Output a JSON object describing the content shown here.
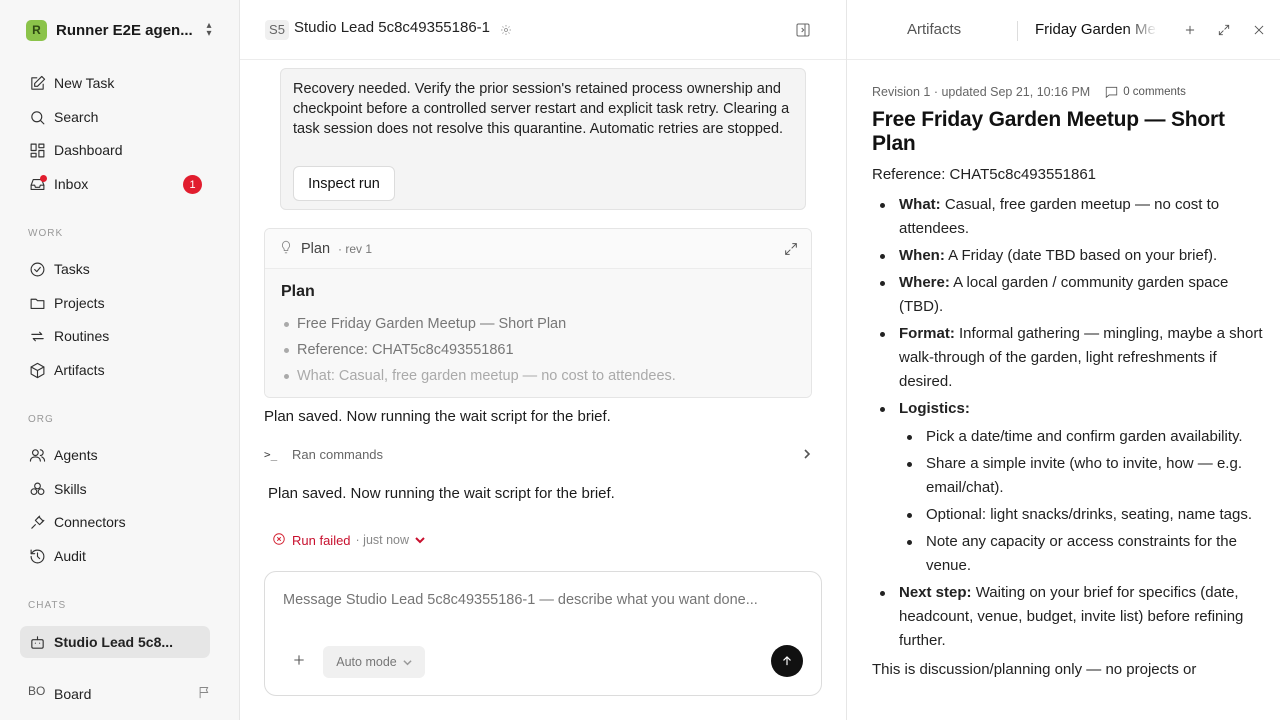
{
  "sidebar": {
    "workspace": {
      "logo": "R",
      "name": "Runner E2E agen..."
    },
    "nav": [
      {
        "label": "New Task",
        "icon": "edit-icon"
      },
      {
        "label": "Search",
        "icon": "search-icon"
      },
      {
        "label": "Dashboard",
        "icon": "dashboard-icon"
      },
      {
        "label": "Inbox",
        "icon": "inbox-icon",
        "badge": "1"
      }
    ],
    "work_label": "WORK",
    "work": [
      {
        "label": "Tasks",
        "icon": "check-circle-icon"
      },
      {
        "label": "Projects",
        "icon": "folder-icon"
      },
      {
        "label": "Routines",
        "icon": "repeat-icon"
      },
      {
        "label": "Artifacts",
        "icon": "cube-icon"
      }
    ],
    "org_label": "ORG",
    "org": [
      {
        "label": "Agents",
        "icon": "users-icon"
      },
      {
        "label": "Skills",
        "icon": "skills-icon"
      },
      {
        "label": "Connectors",
        "icon": "plug-icon"
      },
      {
        "label": "Audit",
        "icon": "history-icon"
      }
    ],
    "chats_label": "CHATS",
    "chats": [
      {
        "label": "Studio Lead 5c8...",
        "icon": "bot-icon",
        "active": true
      }
    ],
    "user": {
      "initials": "BO",
      "name": "Board"
    }
  },
  "main": {
    "header": {
      "badge": "S5",
      "title": "Studio Lead 5c8c49355186-1"
    },
    "recovery": {
      "text": "Recovery needed. Verify the prior session's retained process ownership and checkpoint before a controlled server restart and explicit task retry. Clearing a task session does not resolve this quarantine. Automatic retries are stopped.",
      "button": "Inspect run"
    },
    "plan_card": {
      "label": "Plan",
      "rev": "· rev 1",
      "heading": "Plan",
      "items": [
        "Free Friday Garden Meetup — Short Plan",
        "Reference: CHAT5c8c493551861",
        "What: Casual, free garden meetup — no cost to attendees."
      ]
    },
    "message_1": "Plan saved. Now running the wait script for the brief.",
    "ran_commands": "Ran commands",
    "message_2": "Plan saved. Now running the wait script for the brief.",
    "run_status": {
      "label": "Run failed",
      "time": "· just now"
    },
    "composer": {
      "placeholder": "Message Studio Lead 5c8c49355186-1 — describe what you want done...",
      "mode": "Auto mode"
    }
  },
  "right_panel": {
    "tabs": {
      "artifacts": "Artifacts",
      "active": "Friday Garden Meetup"
    },
    "doc": {
      "meta": "Revision 1 · updated Sep 21, 10:16 PM",
      "comments": "0 comments",
      "title": "Free Friday Garden Meetup — Short Plan",
      "reference": "Reference: CHAT5c8c493551861",
      "bullets": [
        {
          "label": "What:",
          "text": " Casual, free garden meetup — no cost to attendees."
        },
        {
          "label": "When:",
          "text": " A Friday (date TBD based on your brief)."
        },
        {
          "label": "Where:",
          "text": " A local garden / community garden space (TBD)."
        },
        {
          "label": "Format:",
          "text": " Informal gathering — mingling, maybe a short walk-through of the garden, light refreshments if desired."
        },
        {
          "label": "Logistics:",
          "text": ""
        }
      ],
      "logistics": [
        "Pick a date/time and confirm garden availability.",
        "Share a simple invite (who to invite, how — e.g. email/chat).",
        "Optional: light snacks/drinks, seating, name tags.",
        "Note any capacity or access constraints for the venue."
      ],
      "next_step": {
        "label": "Next step:",
        "text": " Waiting on your brief for specifics (date, headcount, venue, budget, invite list) before refining further."
      },
      "footer": "This is discussion/planning only — no projects or"
    }
  }
}
